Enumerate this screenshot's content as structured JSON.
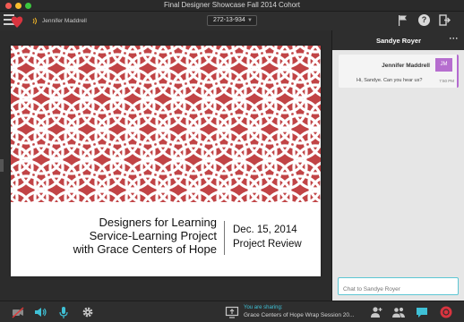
{
  "window": {
    "title": "Final Designer Showcase Fall 2014 Cohort"
  },
  "toolbar": {
    "presenter_name": "Jennifer Maddrell",
    "session_id": "272-13-934"
  },
  "slide": {
    "title_lines": [
      "Designers for Learning",
      "Service-Learning Project",
      "with Grace Centers of Hope"
    ],
    "date": "Dec. 15, 2014",
    "subtitle": "Project Review",
    "pattern_color": "#c14446"
  },
  "chat": {
    "header_title": "Sandye Royer",
    "more_label": "···",
    "messages": [
      {
        "sender": "Jennifer Maddrell",
        "avatar_initials": "JM",
        "text": "Hi, Sandye. Can you hear us?",
        "time": "7:50 PM"
      }
    ],
    "input_placeholder": "Chat to Sandye Royer"
  },
  "bottombar": {
    "sharing_label": "You are sharing:",
    "sharing_value": "Grace Centers of Hope Wrap Session 20..."
  },
  "colors": {
    "accent": "#3fc1d6",
    "avatar": "#b66ecf",
    "record": "#d9343f"
  }
}
